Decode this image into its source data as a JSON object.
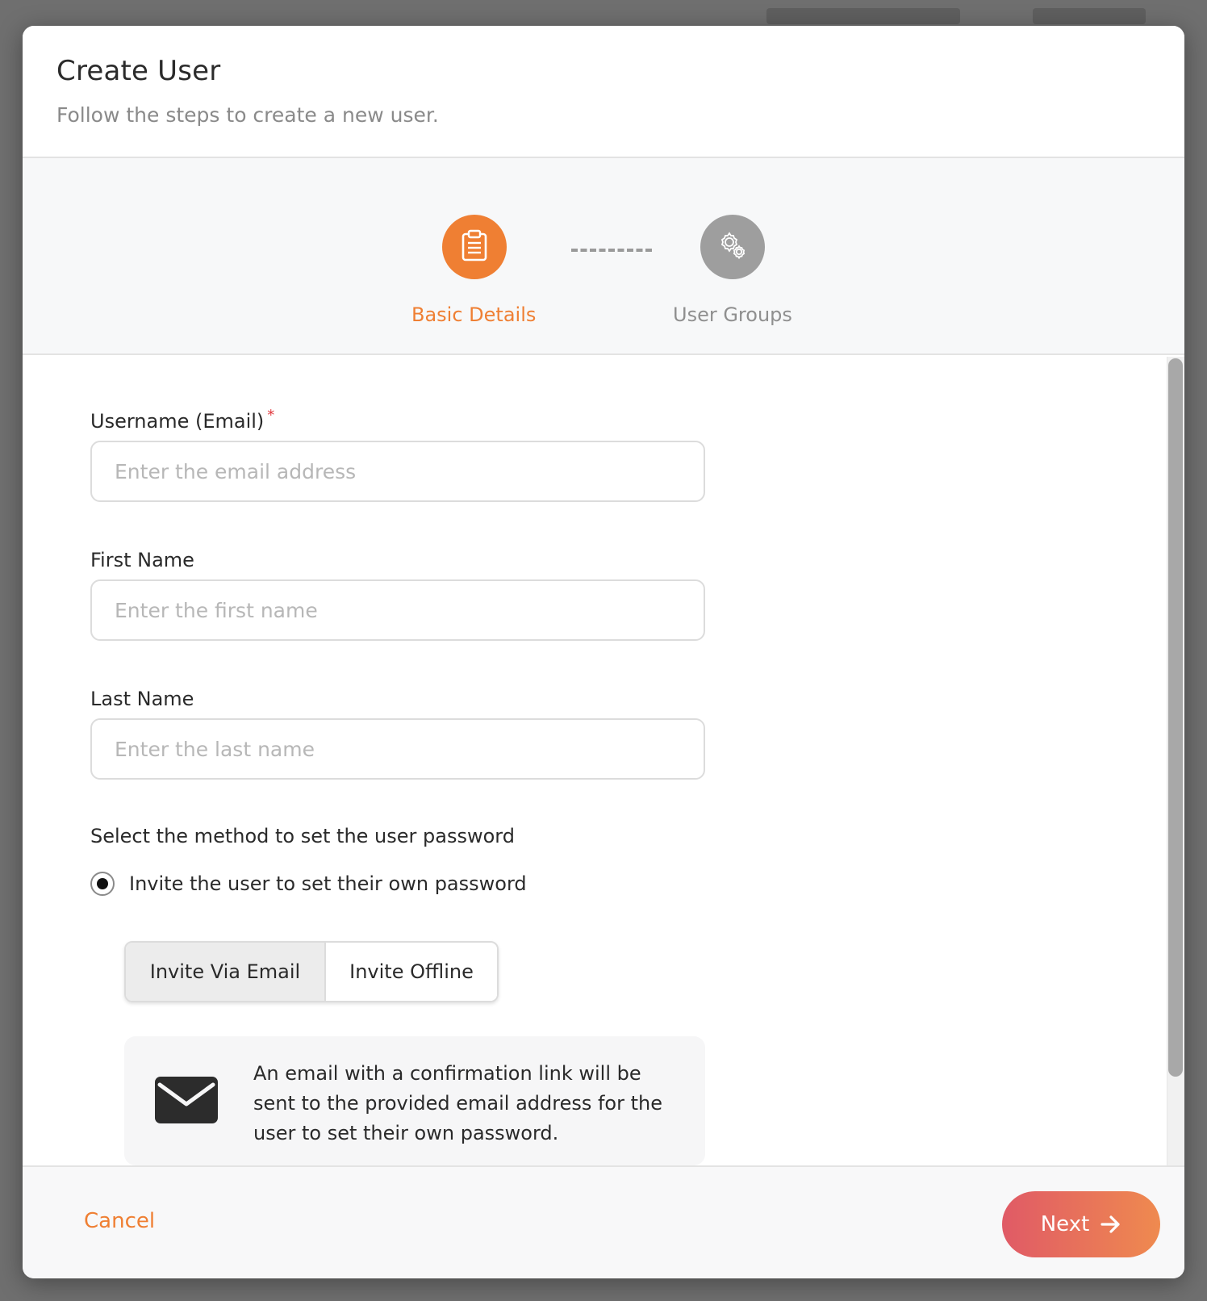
{
  "dialog": {
    "title": "Create User",
    "subtitle": "Follow the steps to create a new user."
  },
  "stepper": {
    "steps": [
      {
        "label": "Basic Details",
        "icon": "clipboard-icon",
        "state": "active"
      },
      {
        "label": "User Groups",
        "icon": "gears-icon",
        "state": "inactive"
      }
    ],
    "active_color": "#ef7f33",
    "inactive_color": "#9e9e9e"
  },
  "form": {
    "username": {
      "label": "Username (Email)",
      "required_mark": "*",
      "placeholder": "Enter the email address",
      "value": ""
    },
    "first_name": {
      "label": "First Name",
      "placeholder": "Enter the first name",
      "value": ""
    },
    "last_name": {
      "label": "Last Name",
      "placeholder": "Enter the last name",
      "value": ""
    },
    "password_method": {
      "heading": "Select the method to set the user password",
      "option_label": "Invite the user to set their own password",
      "selected": true
    },
    "invite_mode": {
      "options": [
        "Invite Via Email",
        "Invite Offline"
      ],
      "selected": "Invite Via Email"
    },
    "info": {
      "icon": "envelope-icon",
      "text": "An email with a confirmation link will be sent to the provided email address for the user to set their own password."
    }
  },
  "footer": {
    "cancel_label": "Cancel",
    "next_label": "Next",
    "next_icon": "arrow-right-icon"
  }
}
